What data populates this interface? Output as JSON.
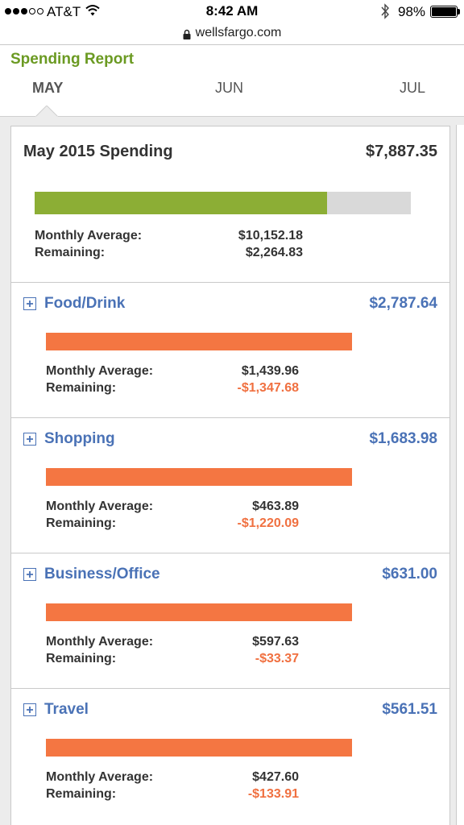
{
  "status_bar": {
    "carrier": "AT&T",
    "time": "8:42 AM",
    "battery_percent": "98%",
    "signal_bars_filled": 3,
    "signal_bars_total": 5
  },
  "browser": {
    "url": "wellsfargo.com"
  },
  "report": {
    "title": "Spending Report",
    "months": [
      "MAY",
      "JUN",
      "JUL"
    ],
    "active_month": "MAY"
  },
  "summary": {
    "title": "May 2015 Spending",
    "amount": "$7,887.35",
    "progress_fraction": 0.777,
    "monthly_average_label": "Monthly Average:",
    "monthly_average": "$10,152.18",
    "remaining_label": "Remaining:",
    "remaining": "$2,264.83"
  },
  "categories": [
    {
      "name": "Food/Drink",
      "amount": "$2,787.64",
      "progress_fraction": 1.0,
      "monthly_average_label": "Monthly Average:",
      "monthly_average": "$1,439.96",
      "remaining_label": "Remaining:",
      "remaining": "-$1,347.68"
    },
    {
      "name": "Shopping",
      "amount": "$1,683.98",
      "progress_fraction": 1.0,
      "monthly_average_label": "Monthly Average:",
      "monthly_average": "$463.89",
      "remaining_label": "Remaining:",
      "remaining": "-$1,220.09"
    },
    {
      "name": "Business/Office",
      "amount": "$631.00",
      "progress_fraction": 1.0,
      "monthly_average_label": "Monthly Average:",
      "monthly_average": "$597.63",
      "remaining_label": "Remaining:",
      "remaining": "-$33.37"
    },
    {
      "name": "Travel",
      "amount": "$561.51",
      "progress_fraction": 1.0,
      "monthly_average_label": "Monthly Average:",
      "monthly_average": "$427.60",
      "remaining_label": "Remaining:",
      "remaining": "-$133.91"
    }
  ],
  "colors": {
    "report_title": "#6b9a22",
    "summary_bar": "#8cae35",
    "category_bar": "#f47642",
    "bar_track": "#d9d9d9",
    "category_text": "#4a72b6",
    "negative_value": "#f07040"
  },
  "icons": {
    "expand": "plus-box-icon",
    "wifi": "wifi-icon",
    "bluetooth": "bluetooth-icon",
    "lock": "lock-icon",
    "battery": "battery-icon"
  }
}
